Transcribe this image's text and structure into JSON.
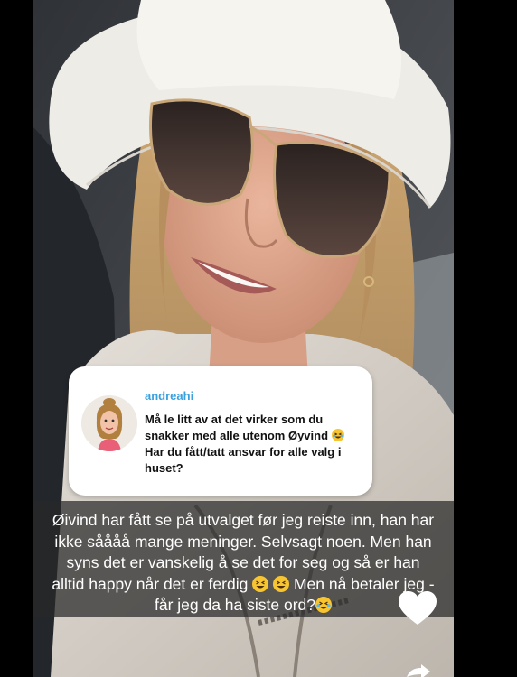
{
  "question": {
    "username": "andreahi",
    "text_part1": "Må le litt av at det virker som du snakker med alle utenom Øyvind ",
    "text_part2": " Har du fått/tatt ansvar for alle valg i huset?"
  },
  "caption": {
    "text_part1": "Øivind har fått se på utvalget før jeg reiste inn, han har ikke såååå mange meninger. Selvsagt noen. Men han syns det er vanskelig å se det for seg og så er han alltid happy når det er ferdig ",
    "text_part2": " Men nå betaler jeg - får jeg da ha siste ord?"
  },
  "icons": {
    "like": "heart-icon",
    "share": "share-arrow-icon",
    "emoji_laugh": "laughing-emoji-icon",
    "emoji_grin": "grinning-squint-emoji-icon"
  },
  "colors": {
    "handle": "#3aa1e0",
    "card": "#ffffff",
    "caption_bg": "rgba(40,40,40,0.72)"
  }
}
